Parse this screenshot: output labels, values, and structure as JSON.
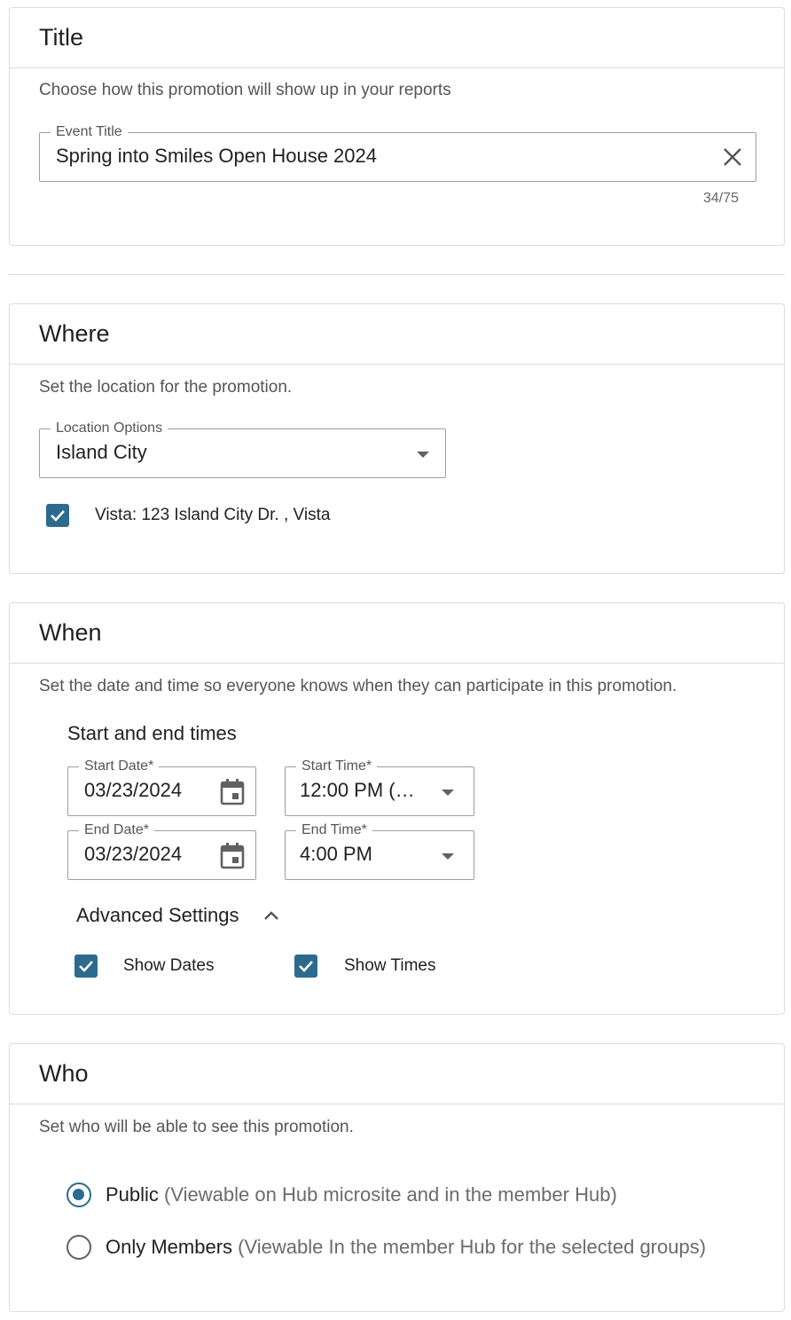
{
  "title_section": {
    "heading": "Title",
    "description": "Choose how this promotion will show up in your reports",
    "event_title": {
      "label": "Event Title",
      "value": "Spring into Smiles Open House 2024",
      "counter": "34/75"
    }
  },
  "where_section": {
    "heading": "Where",
    "description": "Set the location for the promotion.",
    "location": {
      "label": "Location Options",
      "value": "Island City"
    },
    "location_checkbox": {
      "label": "Vista: 123 Island City Dr. , Vista",
      "checked": true
    }
  },
  "when_section": {
    "heading": "When",
    "description": "Set the date and time so everyone knows when they can participate in this promotion.",
    "subheading": "Start and end times",
    "start_date": {
      "label": "Start Date",
      "required_mark": "*",
      "value": "03/23/2024"
    },
    "start_time": {
      "label": "Start Time",
      "required_mark": "*",
      "value": "12:00 PM (…"
    },
    "end_date": {
      "label": "End Date",
      "required_mark": "*",
      "value": "03/23/2024"
    },
    "end_time": {
      "label": "End Time",
      "required_mark": "*",
      "value": "4:00 PM"
    },
    "advanced": {
      "label": "Advanced Settings",
      "expanded": true,
      "show_dates": {
        "label": "Show Dates",
        "checked": true
      },
      "show_times": {
        "label": "Show Times",
        "checked": true
      }
    }
  },
  "who_section": {
    "heading": "Who",
    "description": "Set who will be able to see this promotion.",
    "options": [
      {
        "label": "Public",
        "detail": "(Viewable on Hub microsite and in the member Hub)",
        "selected": true
      },
      {
        "label": "Only Members",
        "detail": "(Viewable In the member Hub for the selected groups)",
        "selected": false
      }
    ]
  },
  "colors": {
    "accent": "#2d6a8e",
    "border": "#dcdcdc",
    "muted_text": "#555555"
  }
}
